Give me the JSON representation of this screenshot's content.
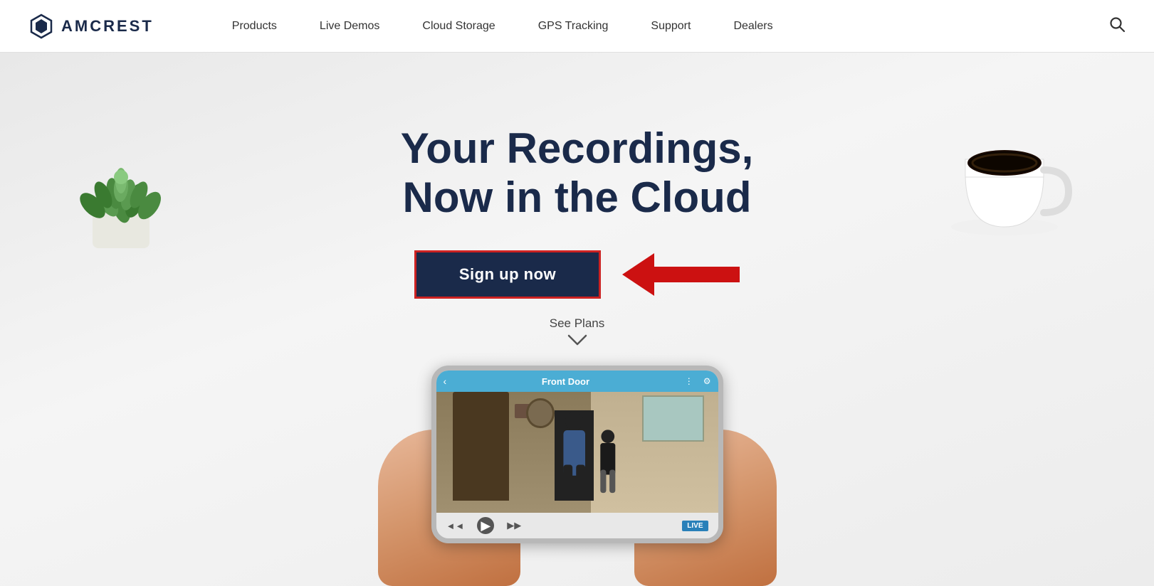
{
  "brand": {
    "name": "AMCREST",
    "logo_alt": "Amcrest logo hexagon"
  },
  "nav": {
    "links": [
      {
        "label": "Products",
        "id": "products"
      },
      {
        "label": "Live Demos",
        "id": "live-demos"
      },
      {
        "label": "Cloud Storage",
        "id": "cloud-storage"
      },
      {
        "label": "GPS Tracking",
        "id": "gps-tracking"
      },
      {
        "label": "Support",
        "id": "support"
      },
      {
        "label": "Dealers",
        "id": "dealers"
      }
    ]
  },
  "hero": {
    "title_line1": "Your Recordings,",
    "title_line2": "Now in the Cloud",
    "cta_button": "Sign up now",
    "see_plans": "See Plans",
    "chevron": "∨"
  },
  "phone": {
    "header_title": "Front Door",
    "live_label": "LIVE"
  },
  "colors": {
    "brand_dark": "#1a2a4a",
    "btn_border": "#cc2222",
    "arrow_red": "#cc1111",
    "nav_bg": "#ffffff",
    "phone_header": "#4badd4"
  }
}
